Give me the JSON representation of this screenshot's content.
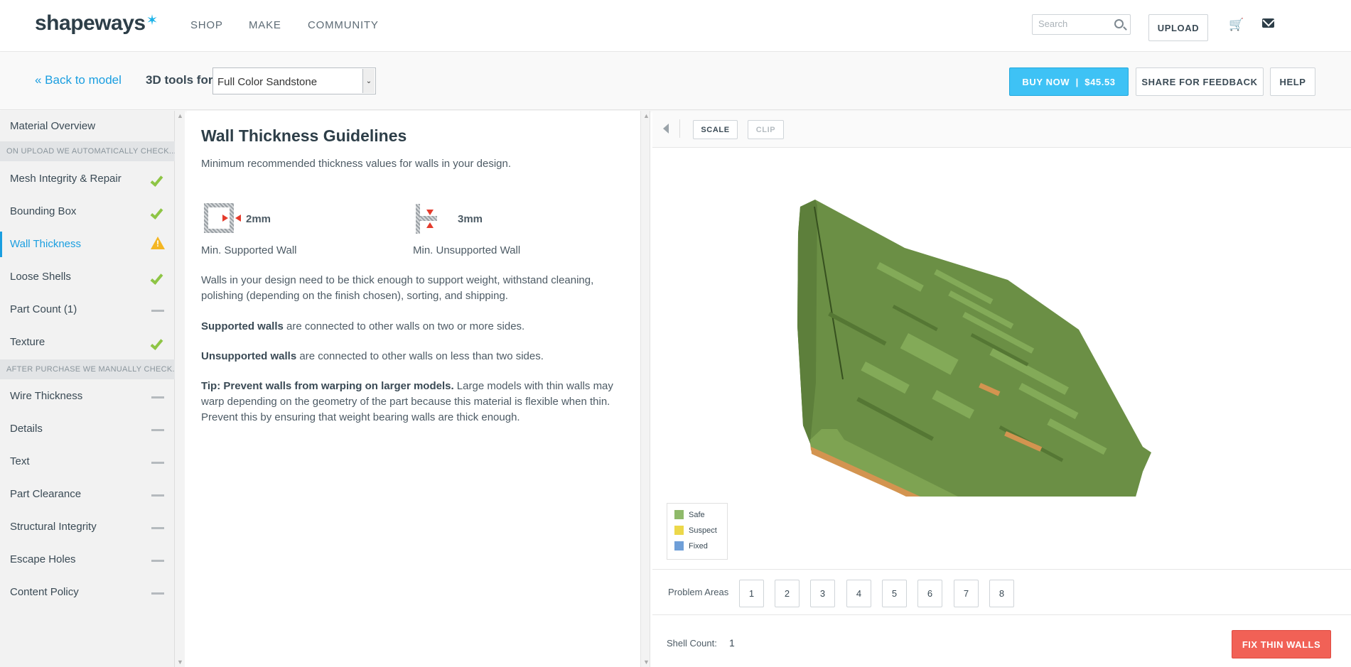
{
  "nav": {
    "logo": "shapeways",
    "links": [
      "SHOP",
      "MAKE",
      "COMMUNITY"
    ],
    "search_placeholder": "Search",
    "upload": "UPLOAD"
  },
  "toolbar": {
    "back": "« Back to model",
    "tools_for": "3D tools for",
    "material": "Full Color Sandstone",
    "buy": "BUY NOW  |  $45.53",
    "share": "SHARE FOR FEEDBACK",
    "help": "HELP"
  },
  "sidebar": {
    "overview": "Material Overview",
    "auto_header": "ON UPLOAD WE AUTOMATICALLY CHECK...",
    "auto_items": [
      {
        "label": "Mesh Integrity & Repair",
        "status": "ok"
      },
      {
        "label": "Bounding Box",
        "status": "ok"
      },
      {
        "label": "Wall Thickness",
        "status": "warn"
      },
      {
        "label": "Loose Shells",
        "status": "ok"
      },
      {
        "label": "Part Count (1)",
        "status": "none"
      },
      {
        "label": "Texture",
        "status": "ok"
      }
    ],
    "manual_header": "AFTER PURCHASE WE MANUALLY CHECK...",
    "manual_items": [
      {
        "label": "Wire Thickness",
        "status": "none"
      },
      {
        "label": "Details",
        "status": "none"
      },
      {
        "label": "Text",
        "status": "none"
      },
      {
        "label": "Part Clearance",
        "status": "none"
      },
      {
        "label": "Structural Integrity",
        "status": "none"
      },
      {
        "label": "Escape Holes",
        "status": "none"
      },
      {
        "label": "Content Policy",
        "status": "none"
      }
    ]
  },
  "content": {
    "title": "Wall Thickness Guidelines",
    "intro": "Minimum recommended thickness values for walls in your design.",
    "supported_value": "2mm",
    "supported_caption": "Min. Supported Wall",
    "unsupported_value": "3mm",
    "unsupported_caption": "Min. Unsupported Wall",
    "para1": "Walls in your design need to be thick enough to support weight, withstand cleaning, polishing (depending on the finish chosen), sorting, and shipping.",
    "supported_bold": "Supported walls",
    "supported_rest": " are connected to other walls on two or more sides.",
    "unsupported_bold": "Unsupported walls",
    "unsupported_rest": " are connected to other walls on less than two sides.",
    "tip_bold": "Tip: Prevent walls from warping on larger models.",
    "tip_rest": " Large models with thin walls may warp depending on the geometry of the part because this material is flexible when thin. Prevent this by ensuring that weight bearing walls are thick enough."
  },
  "viewer": {
    "scale": "SCALE",
    "clip": "CLIP",
    "legend": [
      {
        "label": "Safe",
        "color": "#8fba6a"
      },
      {
        "label": "Suspect",
        "color": "#ecd84a"
      },
      {
        "label": "Fixed",
        "color": "#6f9fd8"
      }
    ],
    "problem_label": "Problem Areas",
    "problem_areas": [
      "1",
      "2",
      "3",
      "4",
      "5",
      "6",
      "7",
      "8"
    ],
    "shell_label": "Shell Count:",
    "shell_value": "1",
    "fix": "FIX THIN WALLS"
  },
  "colors": {
    "accent": "#1a9ee0",
    "buy": "#3ec2f5",
    "fix": "#f16156",
    "model_top": "#6b8f45",
    "model_side": "#d39450"
  }
}
